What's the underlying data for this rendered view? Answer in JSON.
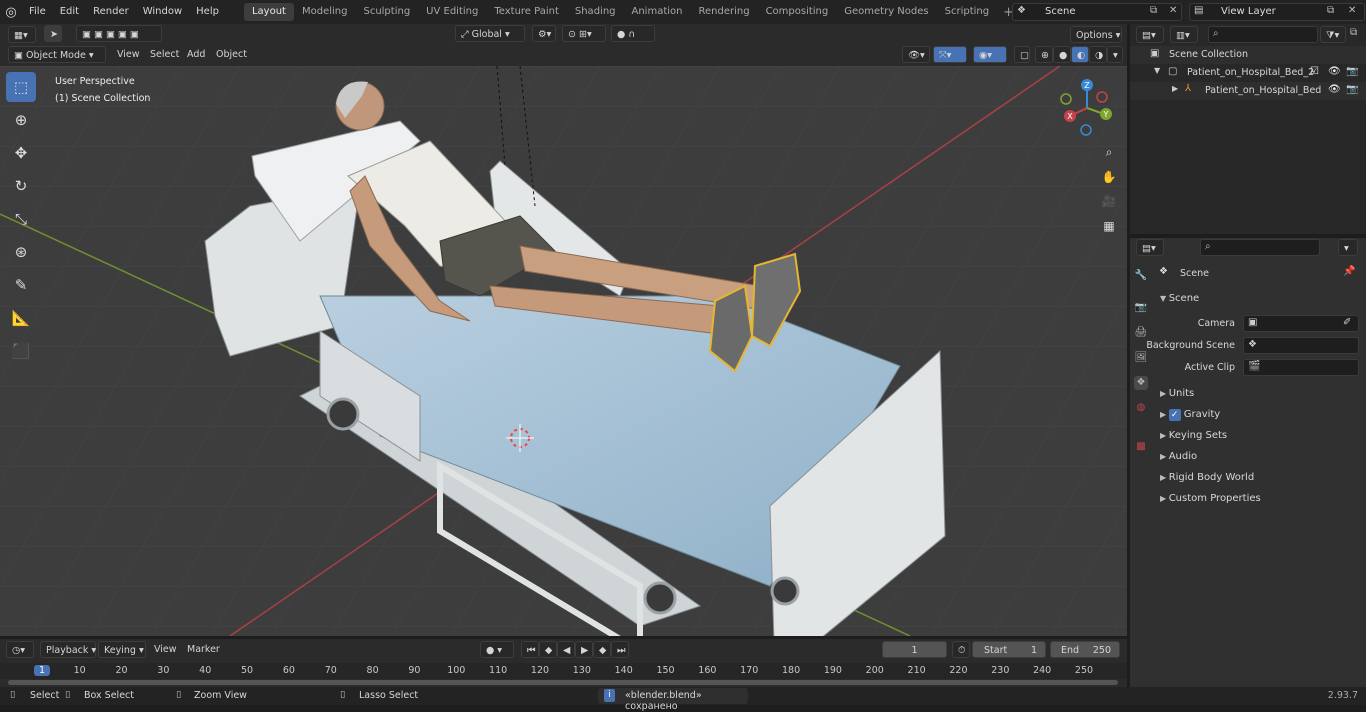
{
  "menu": [
    "File",
    "Edit",
    "Render",
    "Window",
    "Help"
  ],
  "workspaces": [
    {
      "label": "Layout",
      "active": true
    },
    {
      "label": "Modeling"
    },
    {
      "label": "Sculpting"
    },
    {
      "label": "UV Editing"
    },
    {
      "label": "Texture Paint"
    },
    {
      "label": "Shading"
    },
    {
      "label": "Animation"
    },
    {
      "label": "Rendering"
    },
    {
      "label": "Compositing"
    },
    {
      "label": "Geometry Nodes"
    },
    {
      "label": "Scripting"
    }
  ],
  "scene_field": "Scene",
  "view_layer_field": "View Layer",
  "toolbar": {
    "transform_orientation": "Global",
    "options": "Options"
  },
  "viewport_header": {
    "mode": "Object Mode",
    "view": "View",
    "select": "Select",
    "add": "Add",
    "object": "Object"
  },
  "viewport": {
    "perspective": "User Perspective",
    "collection": "(1) Scene Collection"
  },
  "gizmo": {
    "z": "Z",
    "y": "Y",
    "x": "X"
  },
  "outliner": {
    "root": "Scene Collection",
    "items": [
      "Patient_on_Hospital_Bed_2",
      "Patient_on_Hospital_Bed"
    ]
  },
  "properties": {
    "title": "Scene",
    "section": "Scene",
    "camera_label": "Camera",
    "background_label": "Background Scene",
    "clip_label": "Active Clip",
    "panels": [
      "Units",
      "Gravity",
      "Keying Sets",
      "Audio",
      "Rigid Body World",
      "Custom Properties"
    ]
  },
  "timeline": {
    "playback": "Playback",
    "keying": "Keying",
    "view": "View",
    "marker": "Marker",
    "current_frame": "1",
    "start_label": "Start",
    "start": "1",
    "end_label": "End",
    "end": "250",
    "ruler": [
      "1",
      "10",
      "20",
      "30",
      "40",
      "50",
      "60",
      "70",
      "80",
      "90",
      "100",
      "110",
      "120",
      "130",
      "140",
      "150",
      "160",
      "170",
      "180",
      "190",
      "200",
      "210",
      "220",
      "230",
      "240",
      "250"
    ]
  },
  "status": {
    "select": "Select",
    "box": "Box Select",
    "zoom": "Zoom View",
    "lasso": "Lasso Select",
    "message": "«blender.blend» сохранено",
    "version": "2.93.7"
  },
  "colors": {
    "accent": "#4772b3",
    "axis_x": "#c3434b",
    "axis_y": "#7ea52e",
    "axis_z": "#3a88d8",
    "orange": "#e5952a"
  }
}
